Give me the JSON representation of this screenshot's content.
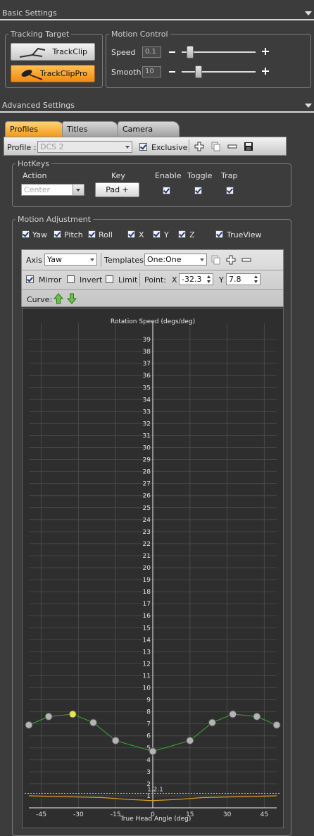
{
  "sections": {
    "basic": "Basic Settings",
    "advanced": "Advanced Settings"
  },
  "tracking": {
    "legend": "Tracking Target",
    "btn1": "TrackClip",
    "btn2": "TrackClipPro"
  },
  "motion_control": {
    "legend": "Motion Control",
    "speed_label": "Speed",
    "speed_value": "0.1",
    "speed_level": 0.07,
    "smooth_label": "Smooth",
    "smooth_value": "10",
    "smooth_level": 0.2
  },
  "tabs": [
    "Profiles",
    "Titles",
    "Camera"
  ],
  "profile": {
    "label": "Profile :",
    "value": "DCS 2",
    "exclusive": "Exclusive"
  },
  "hotkeys": {
    "legend": "HotKeys",
    "col_action": "Action",
    "col_key": "Key",
    "col_enable": "Enable",
    "col_toggle": "Toggle",
    "col_trap": "Trap",
    "action_placeholder": "Center",
    "key_button": "Pad +"
  },
  "motion_adjustment": {
    "legend": "Motion Adjustment",
    "checks": [
      "Yaw",
      "Pitch",
      "Roll",
      "X",
      "Y",
      "Z",
      "TrueView"
    ]
  },
  "curve_toolbar": {
    "axis_label": "Axis",
    "axis_value": "Yaw",
    "templates_label": "Templates",
    "templates_value": "One:One",
    "mirror": "Mirror",
    "invert": "Invert",
    "limit": "Limit",
    "point_label": "Point:",
    "x_label": "X",
    "x_value": "-32.3",
    "y_label": "Y",
    "y_value": "7.8",
    "curve_label": "Curve:"
  },
  "chart_data": {
    "type": "line",
    "title": "Rotation Speed (degs/deg)",
    "xlabel": "True Head Angle (deg)",
    "x_ticks": [
      "-45",
      "-30",
      "-15",
      "0",
      "15",
      "30",
      "45"
    ],
    "y_ticks": [
      "1",
      "2",
      "3",
      "4",
      "5",
      "6",
      "7",
      "8",
      "9",
      "10",
      "11",
      "12",
      "13",
      "14",
      "15",
      "16",
      "17",
      "18",
      "19",
      "20",
      "21",
      "22",
      "23",
      "24",
      "25",
      "26",
      "27",
      "28",
      "29",
      "30",
      "31",
      "32",
      "33",
      "34",
      "35",
      "36",
      "37",
      "38",
      "39"
    ],
    "xlim": [
      -50,
      50
    ],
    "ylim": [
      0,
      40
    ],
    "grid": true,
    "curve": {
      "x": [
        -50,
        -42,
        -32.3,
        -24,
        -15,
        0,
        15,
        24,
        32.3,
        42,
        50
      ],
      "y": [
        6.9,
        7.6,
        7.8,
        7.1,
        5.6,
        4.7,
        5.6,
        7.1,
        7.8,
        7.6,
        6.9
      ]
    },
    "selected_point": [
      -32.3,
      7.8
    ],
    "dashed_line_y": 1.2,
    "annotation": "1.2.1",
    "output_curve": {
      "x": [
        -50,
        -40,
        -30,
        -20,
        -10,
        0,
        10,
        20,
        30,
        40,
        50
      ],
      "y": [
        1.0,
        0.95,
        0.9,
        0.85,
        0.7,
        0.6,
        0.7,
        0.85,
        0.9,
        0.95,
        1.0
      ]
    },
    "colors": {
      "curve": "#3aa830",
      "point": "#b4b4b4",
      "selected": "#e6e64a",
      "output": "#e0a020"
    }
  }
}
